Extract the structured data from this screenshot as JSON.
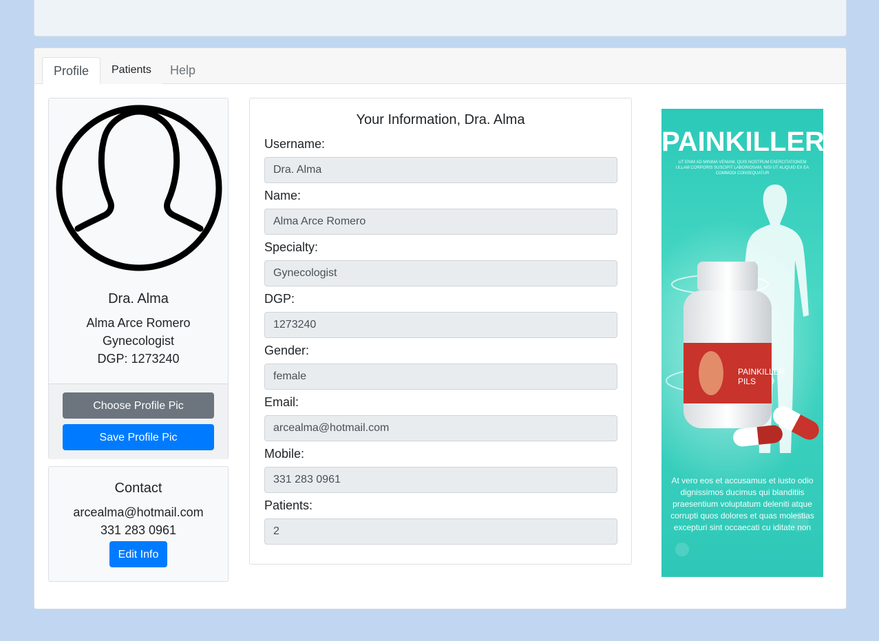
{
  "tabs": [
    {
      "label": "Profile"
    },
    {
      "label": "Patients"
    },
    {
      "label": "Help"
    }
  ],
  "profile": {
    "username": "Dra. Alma",
    "full_name": "Alma Arce Romero",
    "specialty": "Gynecologist",
    "dgp_line": "DGP: 1273240",
    "choose_pic_label": "Choose Profile Pic",
    "save_pic_label": "Save Profile Pic"
  },
  "contact": {
    "title": "Contact",
    "email": "arcealma@hotmail.com",
    "phone": "331 283 0961",
    "edit_label": "Edit Info"
  },
  "info": {
    "title": "Your Information, Dra. Alma",
    "fields": [
      {
        "label": "Username:",
        "value": "Dra. Alma"
      },
      {
        "label": "Name:",
        "value": "Alma Arce Romero"
      },
      {
        "label": "Specialty:",
        "value": "Gynecologist"
      },
      {
        "label": "DGP:",
        "value": "1273240"
      },
      {
        "label": "Gender:",
        "value": "female"
      },
      {
        "label": "Email:",
        "value": "arcealma@hotmail.com"
      },
      {
        "label": "Mobile:",
        "value": "331 283 0961"
      },
      {
        "label": "Patients:",
        "value": "2"
      }
    ]
  },
  "ad": {
    "title": "PAINKILLER",
    "small_text": "UT ENIM AD MINIMA VENIAM, QUIS NOSTRUM EXERCITATIONEM ULLAM CORPORIS SUSCIPIT LABORIOSAM, NISI UT ALIQUID EX EA COMMODI CONSEQUATUR",
    "product_label": "PAINKILLER PILS",
    "body_text": "At vero eos et accusamus et iusto odio dignissimos ducimus qui blanditiis praesentium voluptatum deleniti atque corrupti quos dolores et quas molestias excepturi sint occaecati cu iditate non"
  },
  "colors": {
    "page_bg": "#c1d6f1",
    "primary": "#007bff",
    "secondary": "#6c757d",
    "ad_bg": "#39cfbd"
  }
}
